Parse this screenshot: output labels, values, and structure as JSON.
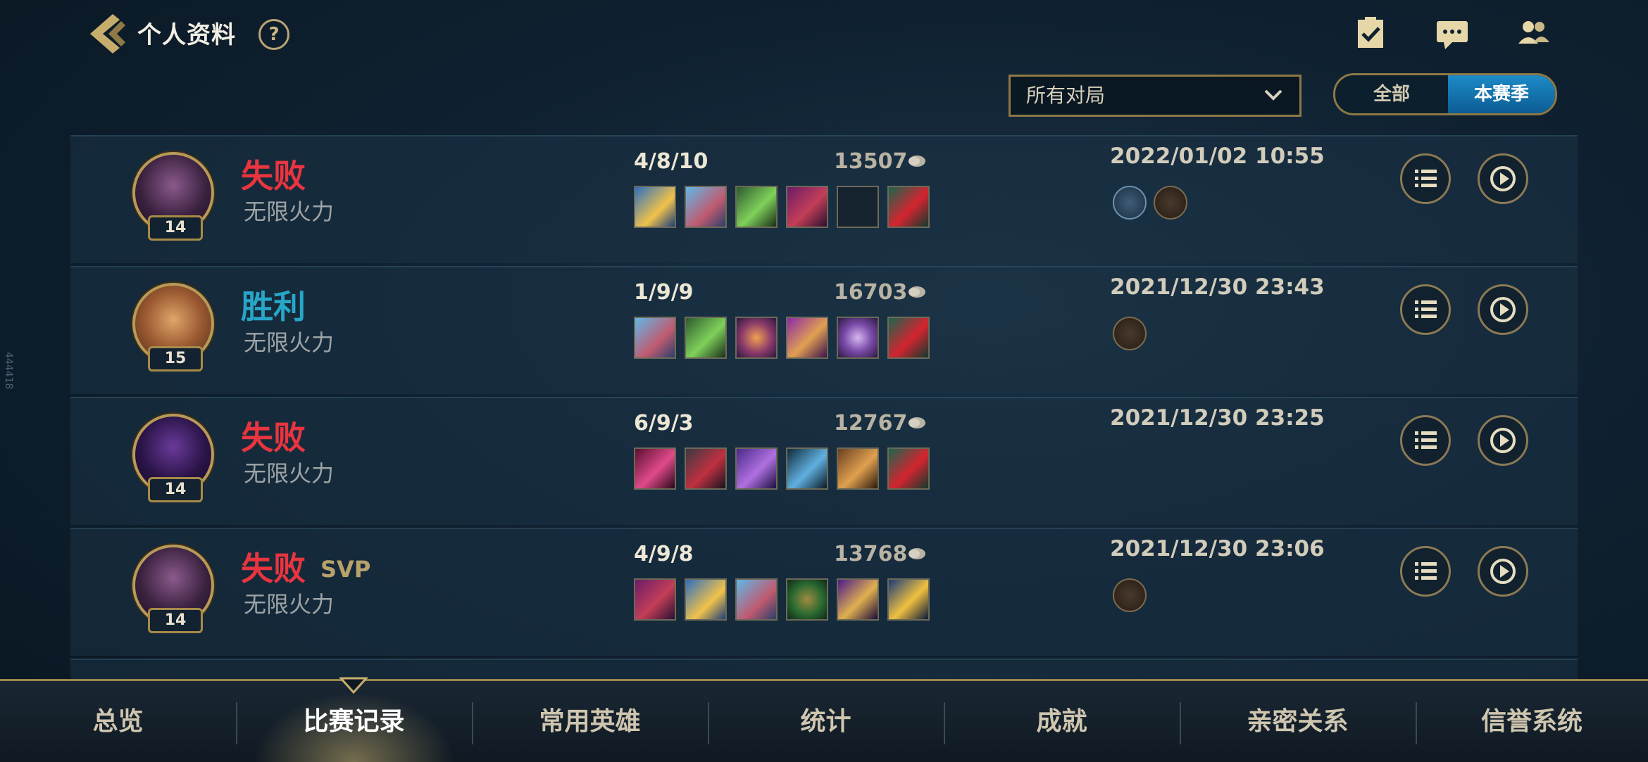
{
  "header": {
    "title": "个人资料",
    "help": "?",
    "icons": [
      "tasks-check-icon",
      "chat-bubble-icon",
      "friends-icon"
    ]
  },
  "filter": {
    "selected": "所有对局"
  },
  "season_toggle": {
    "all": "全部",
    "season": "本赛季",
    "active": "本赛季"
  },
  "side_label": "444418",
  "matches": [
    {
      "result": "失败",
      "result_type": "lose",
      "svp": "",
      "mode": "无限火力",
      "level": "14",
      "kda": "4/8/10",
      "gold": "13507",
      "date": "2022/01/02 10:55",
      "badge_count": 2
    },
    {
      "result": "胜利",
      "result_type": "win",
      "svp": "",
      "mode": "无限火力",
      "level": "15",
      "kda": "1/9/9",
      "gold": "16703",
      "date": "2021/12/30 23:43",
      "badge_count": 1
    },
    {
      "result": "失败",
      "result_type": "lose",
      "svp": "",
      "mode": "无限火力",
      "level": "14",
      "kda": "6/9/3",
      "gold": "12767",
      "date": "2021/12/30 23:25",
      "badge_count": 0
    },
    {
      "result": "失败",
      "result_type": "lose",
      "svp": "SVP",
      "mode": "无限火力",
      "level": "14",
      "kda": "4/9/8",
      "gold": "13768",
      "date": "2021/12/30 23:06",
      "badge_count": 1
    }
  ],
  "tabs": [
    "总览",
    "比赛记录",
    "常用英雄",
    "统计",
    "成就",
    "亲密关系",
    "信誉系统"
  ],
  "active_tab": "比赛记录",
  "colors": {
    "lose": "#e8353f",
    "win": "#27a6c8",
    "gold_accent": "#9c854d",
    "season_active": "#1d8bc7"
  }
}
